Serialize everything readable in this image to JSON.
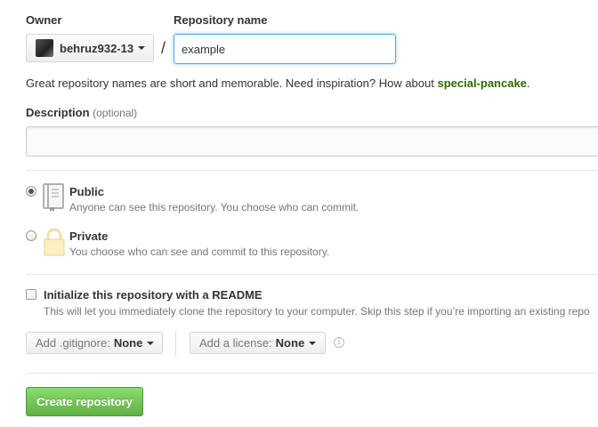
{
  "owner": {
    "label": "Owner",
    "selected": "behruz932-13"
  },
  "separator": "/",
  "repo_name": {
    "label": "Repository name",
    "value": "example"
  },
  "hint": {
    "text": "Great repository names are short and memorable. Need inspiration? How about ",
    "suggestion": "special-pancake",
    "suffix": "."
  },
  "description": {
    "label": "Description",
    "optional": "(optional)",
    "value": ""
  },
  "visibility": {
    "options": [
      {
        "title": "Public",
        "subtitle": "Anyone can see this repository. You choose who can commit.",
        "icon": "book-icon",
        "checked": true
      },
      {
        "title": "Private",
        "subtitle": "You choose who can see and commit to this repository.",
        "icon": "lock-icon",
        "checked": false
      }
    ]
  },
  "readme": {
    "title": "Initialize this repository with a README",
    "subtitle": "This will let you immediately clone the repository to your computer. Skip this step if you’re importing an existing repo",
    "checked": false
  },
  "gitignore": {
    "label": "Add .gitignore:",
    "value": "None"
  },
  "license": {
    "label": "Add a license:",
    "value": "None"
  },
  "create_button": "Create repository",
  "colors": {
    "suggestion": "#2d6c00",
    "create_button": "#60b044",
    "focus_border": "#51a7e8"
  }
}
